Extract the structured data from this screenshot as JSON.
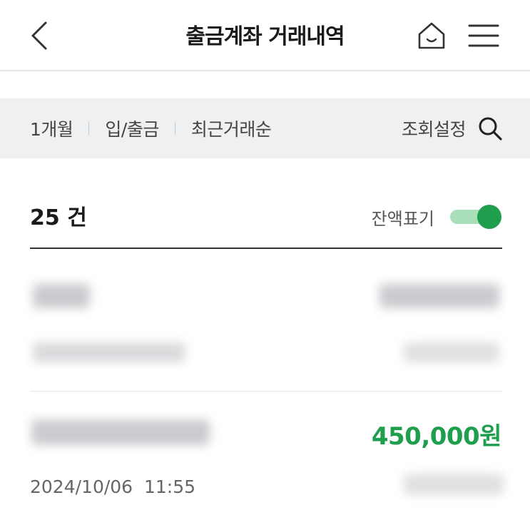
{
  "header": {
    "title": "출금계좌 거래내역",
    "back_icon": "chevron-left-icon",
    "home_icon": "home-icon",
    "menu_icon": "hamburger-menu-icon"
  },
  "filters": {
    "period": "1개월",
    "type": "입/출금",
    "sort": "최근거래순",
    "search_settings_label": "조회설정",
    "search_icon": "search-icon"
  },
  "summary": {
    "count": "25 건",
    "balance_toggle_label": "잔액표기",
    "balance_toggle_on": true
  },
  "transactions": [
    {
      "amount": "450,000원",
      "datetime": "2024/10/06  11:55"
    }
  ],
  "colors": {
    "accent_green": "#1f9e4e",
    "toggle_track": "#a8dfb8",
    "filter_bar_bg": "#eef0f2"
  }
}
